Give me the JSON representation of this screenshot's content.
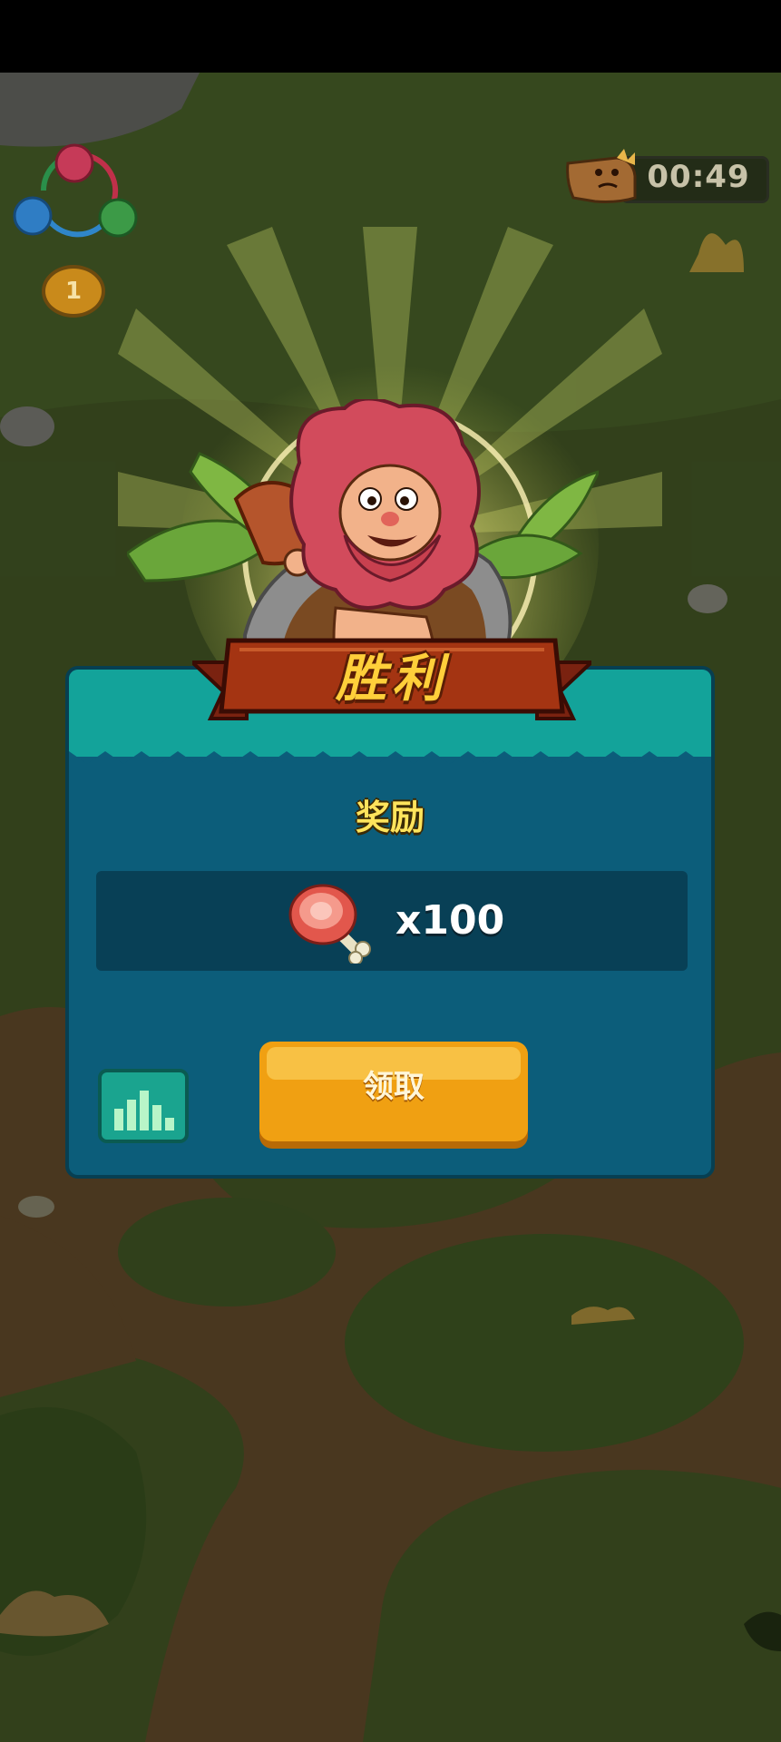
{
  "hud": {
    "level": "1",
    "timer": "00:49"
  },
  "result": {
    "banner": "胜利",
    "reward_title": "奖励",
    "reward_amount": "x100",
    "reward_icon": "meat-icon",
    "claim_label": "领取",
    "stats_icon": "bar-chart-icon"
  },
  "colors": {
    "dialog": "#0c5d7a",
    "dialog_top": "#13a39a",
    "ribbon": "#a43412",
    "claim_button": "#f0a012",
    "title_text": "#ffe45c",
    "grass": "#3b4d22"
  }
}
